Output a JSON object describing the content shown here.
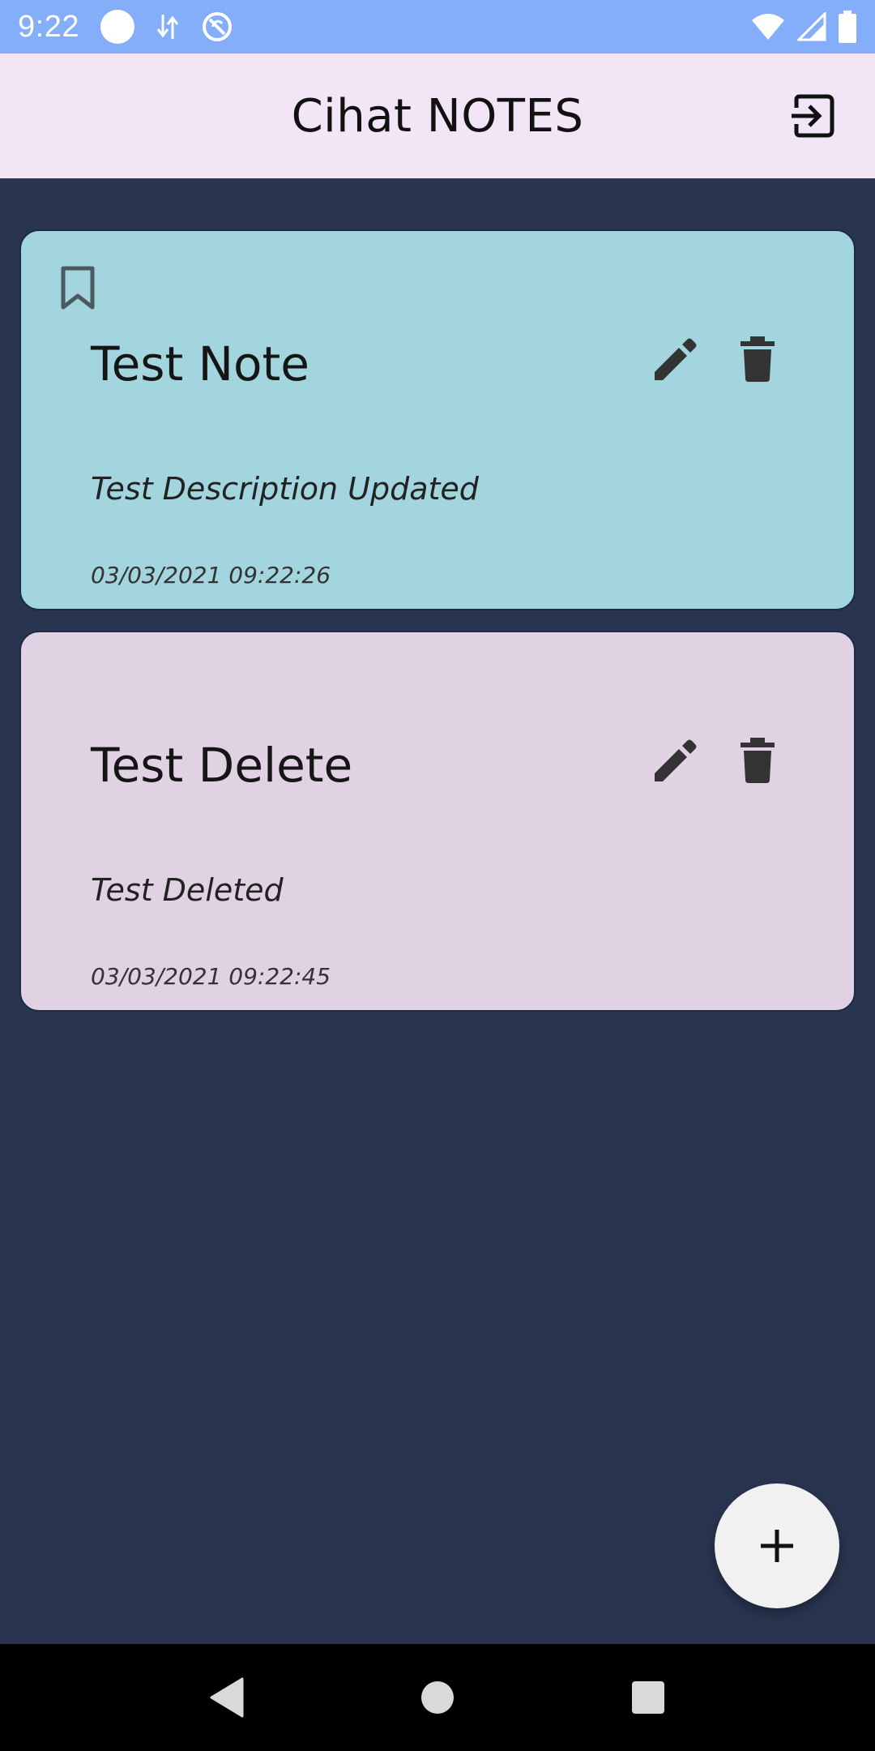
{
  "status_bar": {
    "time": "9:22",
    "icons": [
      "notification-dot-icon",
      "data-transfer-icon",
      "sync-icon",
      "wifi-icon",
      "signal-icon",
      "battery-icon"
    ]
  },
  "app_bar": {
    "title": "Cihat NOTES",
    "logout_icon": "logout-icon"
  },
  "notes": [
    {
      "title": "Test Note",
      "description": "Test Description Updated",
      "date": "03/03/2021 09:22:26",
      "bookmarked": true,
      "color": "#a2d5dd"
    },
    {
      "title": "Test Delete",
      "description": "Test Deleted",
      "date": "03/03/2021 09:22:45",
      "bookmarked": false,
      "color": "#e0d2e3"
    }
  ],
  "fab": {
    "icon": "plus-icon"
  },
  "colors": {
    "status_bar": "#84aef9",
    "app_bar": "#f2e6f6",
    "background": "#293550",
    "icon": "#333333"
  }
}
